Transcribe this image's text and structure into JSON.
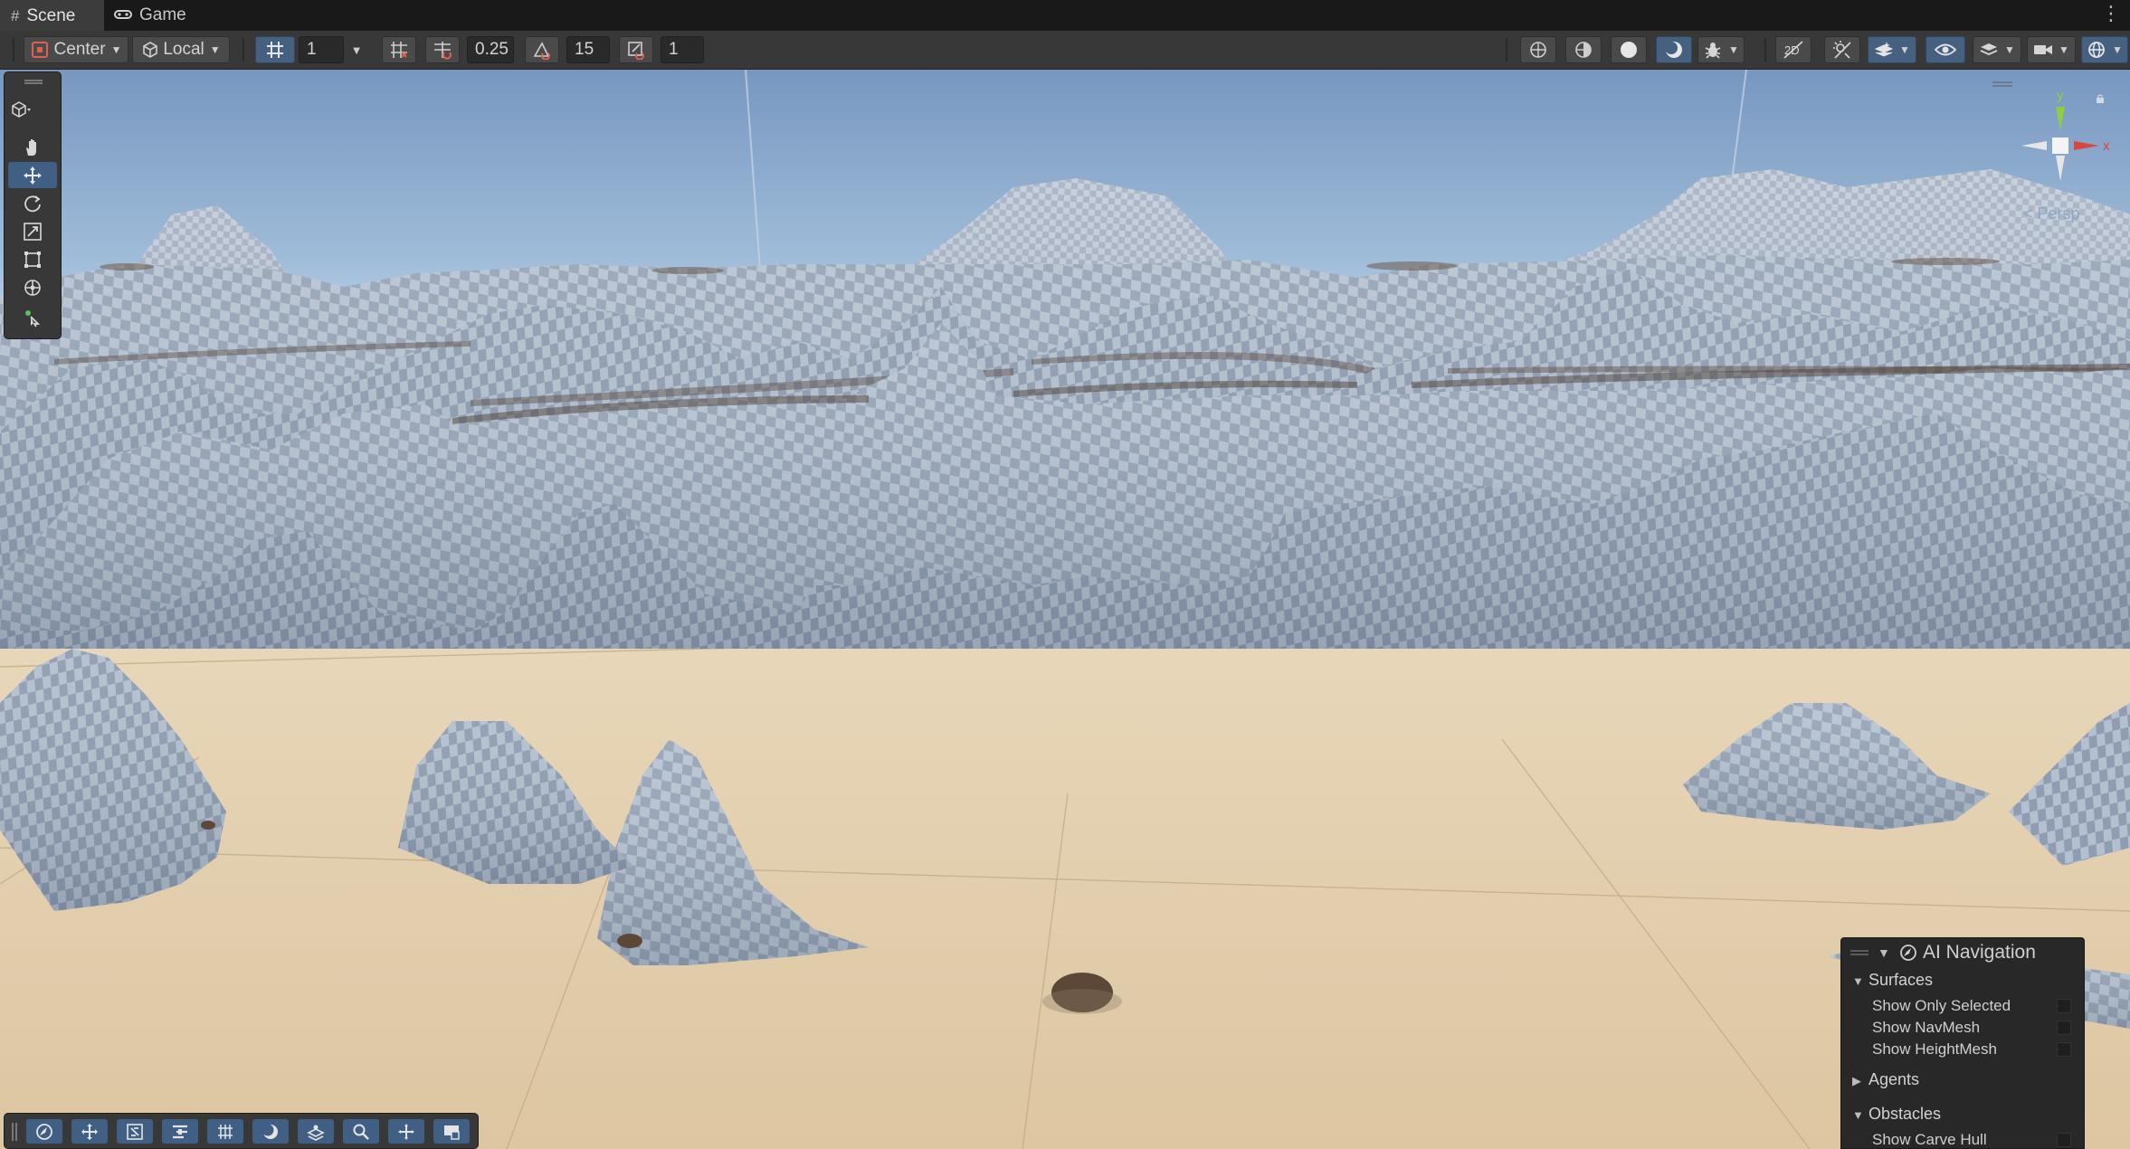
{
  "tabs": {
    "scene": {
      "label": "Scene",
      "icon": "grid-icon"
    },
    "game": {
      "label": "Game",
      "icon": "gamepad-icon"
    }
  },
  "toolbar": {
    "pivot_mode": "Center",
    "pivot_rotation": "Local",
    "grid_size": "1",
    "snap_increment": "0.25",
    "rotation_snap": "15",
    "scale_snap": "1"
  },
  "gizmo": {
    "y_label": "y",
    "x_label": "x",
    "projection": "< Persp"
  },
  "ai_navigation": {
    "title": "AI Navigation",
    "surfaces": {
      "label": "Surfaces",
      "options": [
        "Show Only Selected",
        "Show NavMesh",
        "Show HeightMesh"
      ]
    },
    "agents": {
      "label": "Agents"
    },
    "obstacles": {
      "label": "Obstacles",
      "options": [
        "Show Carve Hull"
      ]
    }
  },
  "colors": {
    "selected_tool": "#3f5f85",
    "sky_top": "#7d9ac2",
    "sky_horizon": "#e4f0f8",
    "ground": "#e2ccaa",
    "terrain": "#a9b6c7",
    "gizmo_x": "#d9473f",
    "gizmo_y": "#8fcf3f"
  }
}
